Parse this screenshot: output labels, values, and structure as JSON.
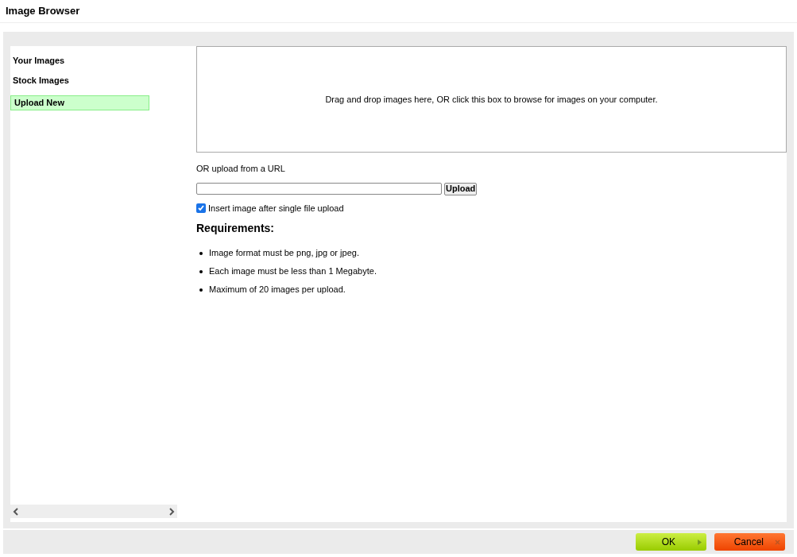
{
  "window": {
    "title": "Image Browser"
  },
  "sidebar": {
    "items": [
      {
        "label": "Your Images",
        "selected": false
      },
      {
        "label": "Stock Images",
        "selected": false
      },
      {
        "label": "Upload New",
        "selected": true
      }
    ]
  },
  "dropzone": {
    "text": "Drag and drop images here, OR click this box to browse for images on your computer."
  },
  "url_upload": {
    "label": "OR upload from a URL",
    "button": "Upload"
  },
  "insert_option": {
    "label": "Insert image after single file upload",
    "checked": true
  },
  "requirements": {
    "heading": "Requirements:",
    "items": [
      "Image format must be png, jpg or jpeg.",
      "Each image must be less than 1 Megabyte.",
      "Maximum of 20 images per upload."
    ]
  },
  "footer": {
    "buttons": [
      {
        "label": "OK",
        "kind": "ok"
      },
      {
        "label": "Cancel",
        "kind": "cancel"
      }
    ]
  }
}
